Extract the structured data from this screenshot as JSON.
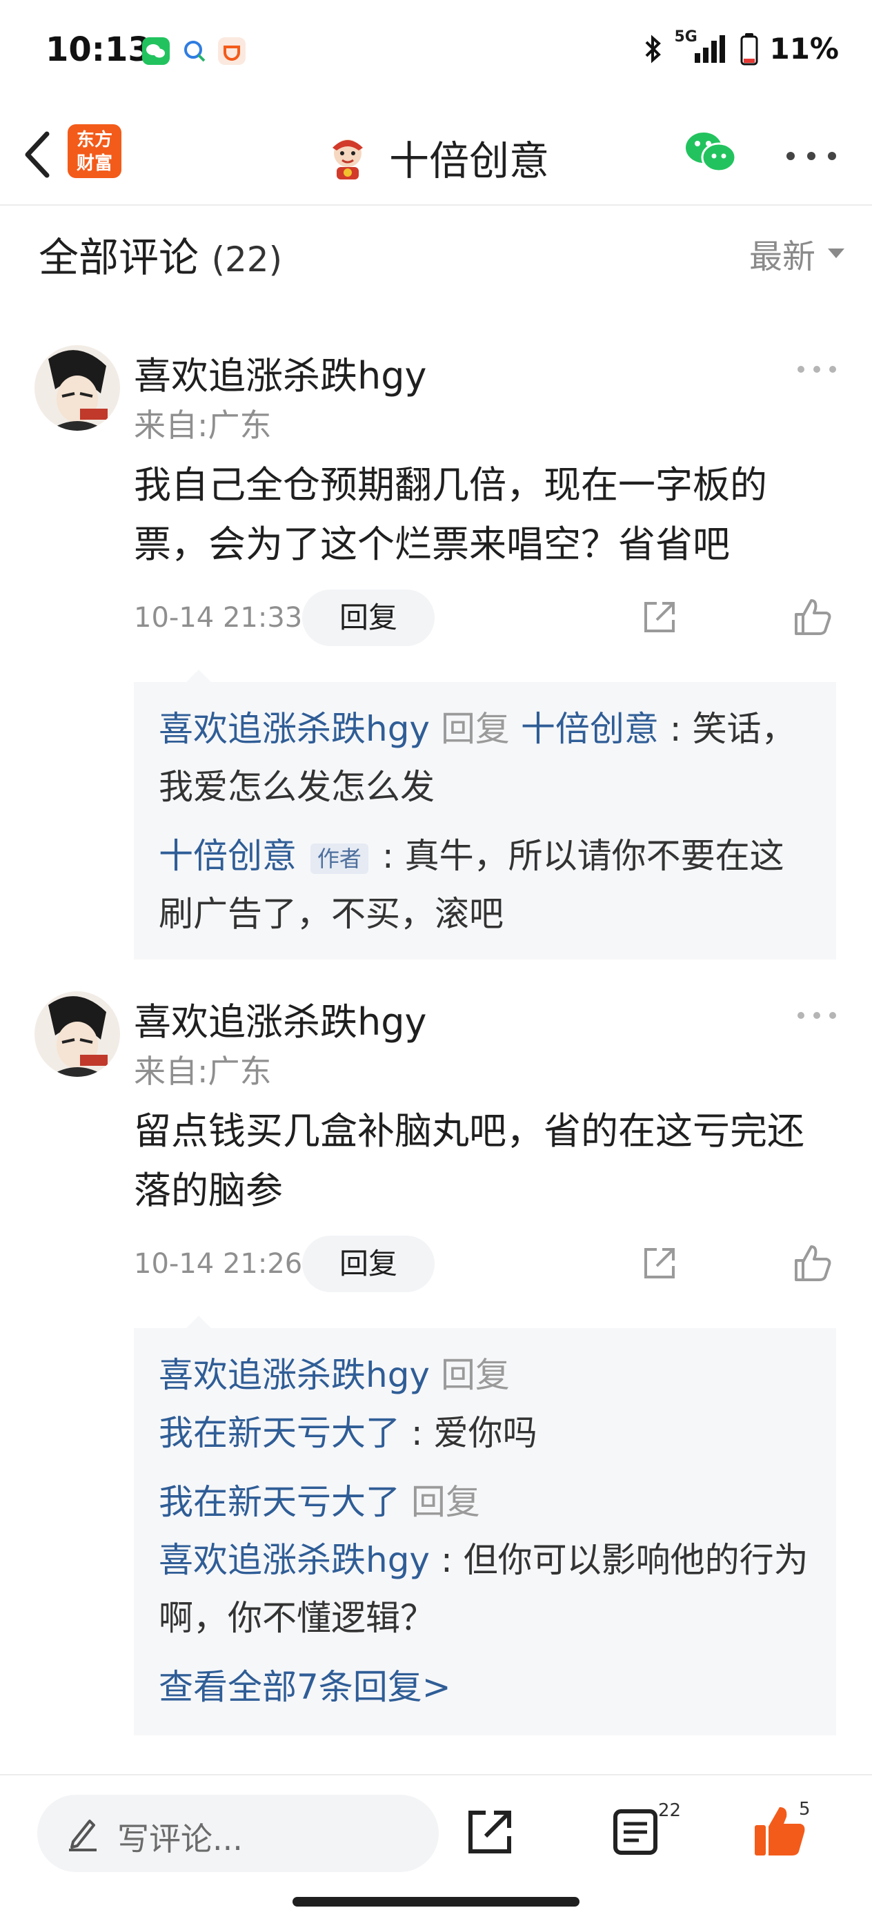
{
  "status_bar": {
    "time": "10:13",
    "network": "5G",
    "battery": "11%",
    "icons": [
      "wechat-icon",
      "search-app-icon",
      "orange-app-icon",
      "bluetooth-icon",
      "signal-icon",
      "battery-icon"
    ]
  },
  "nav": {
    "logo_line1": "东方",
    "logo_line2": "财富",
    "title": "十倍创意",
    "brand_color": "#f35b1a"
  },
  "section": {
    "title": "全部评论",
    "count": "(22)",
    "sort_label": "最新"
  },
  "comments": [
    {
      "username": "喜欢追涨杀跌hgy",
      "location": "来自:广东",
      "text": "我自己全仓预期翻几倍，现在一字板的票，会为了这个烂票来唱空？省省吧",
      "time": "10-14 21:33",
      "reply_label": "回复",
      "replies": [
        {
          "user": "喜欢追涨杀跌hgy",
          "verb": "回复",
          "target": "十倍创意",
          "text": ": 笑话，我爱怎么发怎么发"
        },
        {
          "user": "十倍创意",
          "badge": "作者",
          "text": ": 真牛，所以请你不要在这刷广告了，不买，滚吧"
        }
      ]
    },
    {
      "username": "喜欢追涨杀跌hgy",
      "location": "来自:广东",
      "text": "留点钱买几盒补脑丸吧，省的在这亏完还落的脑参",
      "time": "10-14 21:26",
      "reply_label": "回复",
      "replies": [
        {
          "user": "喜欢追涨杀跌hgy",
          "verb": "回复",
          "target": "我在新天亏大了",
          "text": ": 爱你吗"
        },
        {
          "user": "我在新天亏大了",
          "verb": "回复",
          "target": "喜欢追涨杀跌hgy",
          "text": ": 但你可以影响他的行为啊，你不懂逻辑？"
        }
      ],
      "view_all": "查看全部7条回复>"
    }
  ],
  "bottom_bar": {
    "placeholder": "写评论...",
    "comment_count": "22",
    "like_count": "5",
    "like_color": "#f35b1a"
  }
}
